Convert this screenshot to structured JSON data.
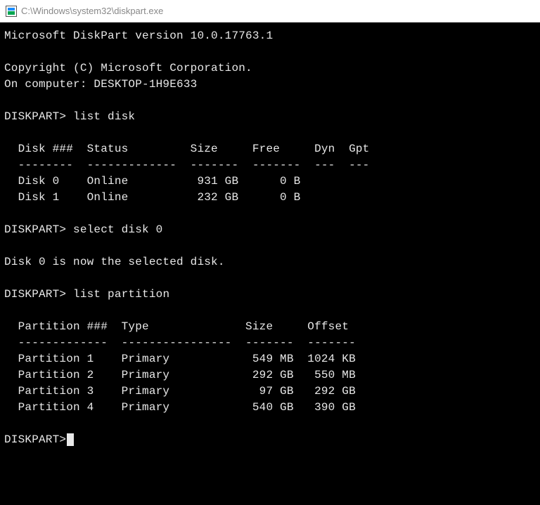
{
  "window": {
    "title": "C:\\Windows\\system32\\diskpart.exe"
  },
  "terminal": {
    "version_line": "Microsoft DiskPart version 10.0.17763.1",
    "copyright": "Copyright (C) Microsoft Corporation.",
    "computer_line": "On computer: DESKTOP-1H9E633",
    "prompt_prefix": "DISKPART>",
    "cmd1": " list disk",
    "disk_header": "  Disk ###  Status         Size     Free     Dyn  Gpt",
    "disk_divider": "  --------  -------------  -------  -------  ---  ---",
    "disk0": "  Disk 0    Online          931 GB      0 B",
    "disk1": "  Disk 1    Online          232 GB      0 B",
    "cmd2": " select disk 0",
    "select_result": "Disk 0 is now the selected disk.",
    "cmd3": " list partition",
    "part_header": "  Partition ###  Type              Size     Offset",
    "part_divider": "  -------------  ----------------  -------  -------",
    "part1": "  Partition 1    Primary            549 MB  1024 KB",
    "part2": "  Partition 2    Primary            292 GB   550 MB",
    "part3": "  Partition 3    Primary             97 GB   292 GB",
    "part4": "  Partition 4    Primary            540 GB   390 GB"
  }
}
